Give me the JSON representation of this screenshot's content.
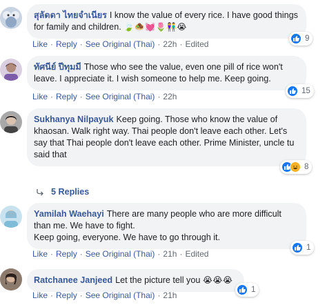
{
  "comments": [
    {
      "author": "สุลัดดา ไทยจำเนียร",
      "text": "I know the value of every rice. I have good things for family and children.",
      "emoji": "🍃🧆💓🌷👫😭",
      "actions": [
        "Like",
        "Reply",
        "See Original (Thai)",
        "22h",
        "Edited"
      ],
      "reaction_count": "9"
    },
    {
      "author": "ทัศนีย์ ปีทุมมี",
      "text": "Those who see the value, even one pill of rice won't leave. I appreciate it. I wish someone to help me. Keep going.",
      "actions": [
        "Like",
        "Reply",
        "See Original (Thai)",
        "22h"
      ],
      "reaction_count": "15"
    },
    {
      "author": "Sukhanya Nilpayuk",
      "text": "Keep going. Those who know the value of khaosan. Walk right way. Thai people don't leave each other. Let's say that Thai people don't leave each other. Prime Minister, uncle tu said that",
      "actions": [
        "Like",
        "Reply",
        "See Original (Thai)",
        "22h"
      ],
      "reaction_count": "8"
    },
    {
      "author": "Yamilah Waehayi",
      "text": "There are many people who are more difficult than me. We have to fight.\nKeep going, everyone. We have to go through it.",
      "actions": [
        "Like",
        "Reply",
        "See Original (Thai)",
        "21h",
        "Edited"
      ],
      "reaction_count": "1"
    },
    {
      "author": "Ratchanee Janjeed",
      "text": "Let the picture tell you",
      "emoji": "😭😭😭",
      "actions": [
        "Like",
        "Reply",
        "See Original (Thai)",
        "21h"
      ],
      "reaction_count": "1"
    }
  ],
  "replies_link": "5 Replies",
  "colors": {
    "link": "#385898",
    "bubble": "#f2f3f5",
    "like": "#1877f2",
    "meta": "#606770"
  }
}
